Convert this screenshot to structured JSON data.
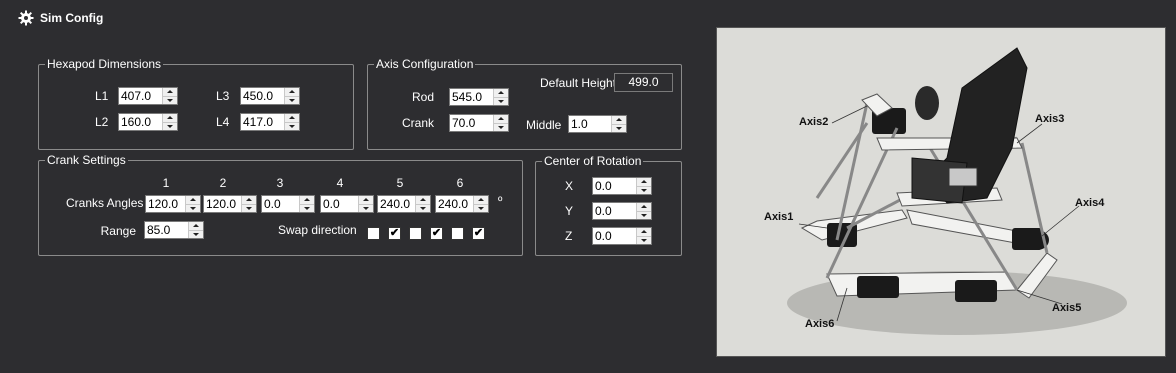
{
  "window": {
    "title": "Sim Config",
    "icon": "gear-icon"
  },
  "hexapod_dimensions": {
    "legend": "Hexapod Dimensions",
    "fields": [
      {
        "label": "L1",
        "value": "407.0"
      },
      {
        "label": "L2",
        "value": "160.0"
      },
      {
        "label": "L3",
        "value": "450.0"
      },
      {
        "label": "L4",
        "value": "417.0"
      }
    ]
  },
  "axis_configuration": {
    "legend": "Axis Configuration",
    "rod": {
      "label": "Rod",
      "value": "545.0"
    },
    "crank": {
      "label": "Crank",
      "value": "70.0"
    },
    "default_height": {
      "label": "Default Height",
      "value": "499.0"
    },
    "middle": {
      "label": "Middle",
      "value": "1.0"
    }
  },
  "crank_settings": {
    "legend": "Crank Settings",
    "column_headers": [
      "1",
      "2",
      "3",
      "4",
      "5",
      "6"
    ],
    "angles_label": "Cranks Angles",
    "angles": [
      "120.0",
      "120.0",
      "0.0",
      "0.0",
      "240.0",
      "240.0"
    ],
    "unit": "º",
    "range": {
      "label": "Range",
      "value": "85.0"
    },
    "swap_label": "Swap direction",
    "swap": [
      false,
      true,
      false,
      true,
      false,
      true
    ]
  },
  "center_of_rotation": {
    "legend": "Center of Rotation",
    "fields": [
      {
        "label": "X",
        "value": "0.0"
      },
      {
        "label": "Y",
        "value": "0.0"
      },
      {
        "label": "Z",
        "value": "0.0"
      }
    ]
  },
  "preview": {
    "axis_labels": [
      "Axis1",
      "Axis2",
      "Axis3",
      "Axis4",
      "Axis5",
      "Axis6"
    ]
  }
}
